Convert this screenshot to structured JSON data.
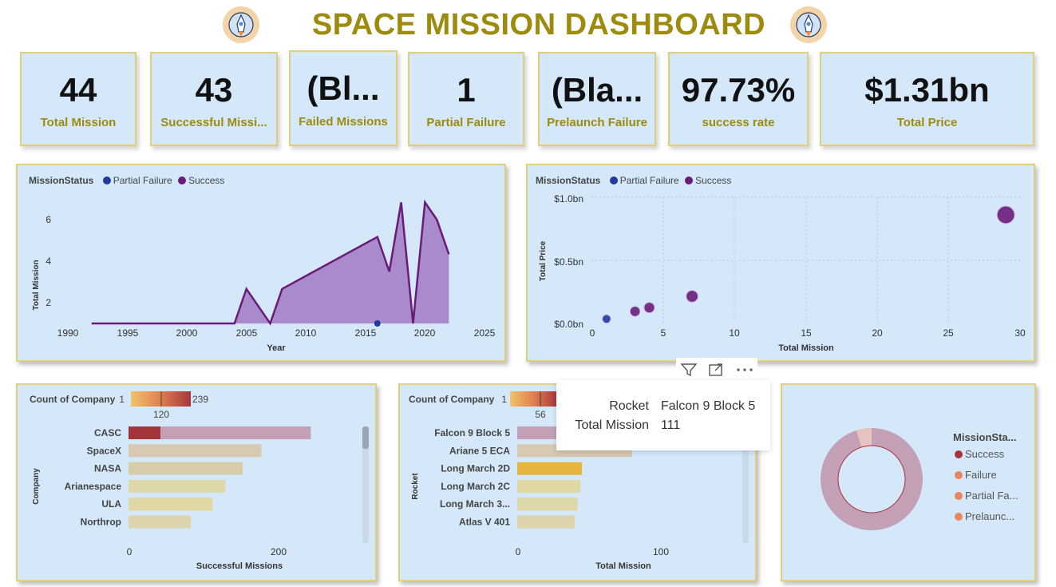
{
  "title": "SPACE MISSION DASHBOARD",
  "kpis": [
    {
      "value": "44",
      "label": "Total Mission"
    },
    {
      "value": "43",
      "label": "Successful Missi..."
    },
    {
      "value": "(Bl...",
      "label": "Failed Missions"
    },
    {
      "value": "1",
      "label": "Partial Failure"
    },
    {
      "value": "(Bla...",
      "label": "Prelaunch Failure"
    },
    {
      "value": "97.73%",
      "label": "success rate"
    },
    {
      "value": "$1.31bn",
      "label": "Total Price"
    }
  ],
  "colors": {
    "panel_bg": "#d4e8fa",
    "gold": "#9c8b0c",
    "success": "#6a1b7a",
    "partial_failure": "#1f3aa0",
    "area_fill": "#a98bcb"
  },
  "area_chart": {
    "legend_title": "MissionStatus",
    "legend": [
      "Partial Failure",
      "Success"
    ],
    "ylabel": "Total Mission",
    "xlabel": "Year",
    "x_ticks": [
      "1990",
      "1995",
      "2000",
      "2005",
      "2010",
      "2015",
      "2020",
      "2025"
    ],
    "y_ticks": [
      "2",
      "4",
      "6"
    ]
  },
  "scatter_chart": {
    "legend_title": "MissionStatus",
    "legend": [
      "Partial Failure",
      "Success"
    ],
    "ylabel": "Total Price",
    "xlabel": "Total Mission",
    "x_ticks": [
      "0",
      "5",
      "10",
      "15",
      "20",
      "25",
      "30"
    ],
    "y_ticks": [
      "$0.0bn",
      "$0.5bn",
      "$1.0bn"
    ]
  },
  "company_chart": {
    "legend_title": "Count of Company",
    "scale_min": "1",
    "scale_mid": "120",
    "scale_max": "239",
    "ylabel": "Company",
    "xlabel": "Successful Missions",
    "x_ticks": [
      "0",
      "200"
    ]
  },
  "rocket_chart": {
    "legend_title": "Count of Company",
    "scale_min": "1",
    "scale_mid": "56",
    "ylabel": "Rocket",
    "xlabel": "Total Mission",
    "x_ticks": [
      "0",
      "100"
    ]
  },
  "tooltip": {
    "rows": [
      {
        "key": "Rocket",
        "value": "Falcon 9 Block 5"
      },
      {
        "key": "Total Mission",
        "value": "111"
      }
    ]
  },
  "visual_header": [
    "filter-icon",
    "focus-mode-icon",
    "more-options-icon"
  ],
  "donut": {
    "legend_title": "MissionSta...",
    "items": [
      {
        "label": "Success",
        "color": "#a4343a"
      },
      {
        "label": "Failure",
        "color": "#e8865f"
      },
      {
        "label": "Partial Fa...",
        "color": "#e8865f"
      },
      {
        "label": "Prelaunc...",
        "color": "#e8865f"
      }
    ]
  },
  "chart_data": [
    {
      "type": "area",
      "xlabel": "Year",
      "ylabel": "Total Mission",
      "xlim": [
        1990,
        2025
      ],
      "ylim": [
        0,
        7.2
      ],
      "series": [
        {
          "name": "Success",
          "x": [
            1992,
            2004,
            2005,
            2007,
            2008,
            2016,
            2017,
            2018,
            2019,
            2020,
            2021,
            2022
          ],
          "y": [
            0,
            0,
            2,
            0,
            2,
            5,
            3,
            7,
            0,
            7,
            6,
            4
          ]
        },
        {
          "name": "Partial Failure",
          "x": [
            2016
          ],
          "y": [
            0
          ]
        }
      ]
    },
    {
      "type": "scatter",
      "xlabel": "Total Mission",
      "ylabel": "Total Price",
      "xlim": [
        0,
        30
      ],
      "ylim": [
        0,
        1.0
      ],
      "series": [
        {
          "name": "Partial Failure",
          "x": [
            1
          ],
          "y": [
            0.03
          ]
        },
        {
          "name": "Success",
          "x": [
            3,
            4,
            7,
            29
          ],
          "y": [
            0.09,
            0.12,
            0.21,
            0.86
          ]
        }
      ]
    },
    {
      "type": "bar",
      "orientation": "horizontal",
      "xlabel": "Successful Missions",
      "ylabel": "Company",
      "xlim": [
        0,
        270
      ],
      "categories": [
        "CASC",
        "SpaceX",
        "NASA",
        "Arianespace",
        "ULA",
        "Northrop"
      ],
      "values": [
        243,
        177,
        152,
        129,
        112,
        83
      ],
      "colors": [
        "#c3a0b6",
        "#d7c9b2",
        "#d8cda9",
        "#ded8a8",
        "#dfd8a4",
        "#ddd4ac"
      ]
    },
    {
      "type": "bar",
      "orientation": "horizontal",
      "xlabel": "Total Mission",
      "ylabel": "Rocket",
      "xlim": [
        0,
        160
      ],
      "categories": [
        "Falcon 9 Block 5",
        "Ariane 5 ECA",
        "Long March 2D",
        "Long March 2C",
        "Long March 3...",
        "Atlas V 401"
      ],
      "values": [
        111,
        80,
        45,
        44,
        42,
        40
      ],
      "colors": [
        "#c3a0b6",
        "#d7c9b2",
        "#e6b53d",
        "#dfd8a4",
        "#ded8a8",
        "#ddd4ac"
      ]
    },
    {
      "type": "pie",
      "categories": [
        "Success",
        "Failure",
        "Partial Failure",
        "Prelaunch Failure"
      ],
      "values": [
        43,
        0,
        1,
        0
      ]
    }
  ]
}
